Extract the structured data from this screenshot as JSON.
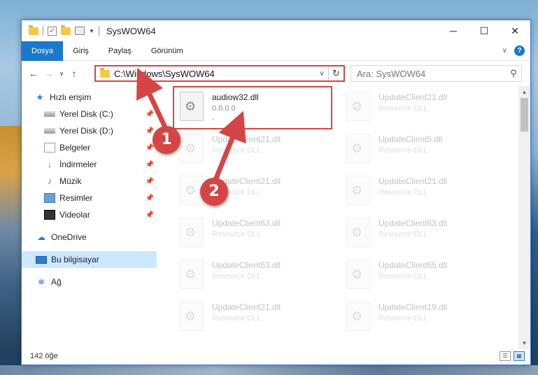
{
  "window": {
    "title": "SysWOW64",
    "controls": {
      "minimize": "─",
      "maximize": "☐",
      "close": "✕"
    }
  },
  "ribbon": {
    "tabs": [
      "Dosya",
      "Giriş",
      "Paylaş",
      "Görünüm"
    ],
    "help": "?"
  },
  "address": {
    "path": "C:\\Windows\\SysWOW64",
    "search_placeholder": "Ara: SysWOW64"
  },
  "nav": {
    "items": [
      {
        "label": "Hızlı erişim",
        "icon": "star-icon",
        "pinned": false
      },
      {
        "label": "Yerel Disk (C:)",
        "icon": "drive-icon",
        "pinned": true
      },
      {
        "label": "Yerel Disk (D:)",
        "icon": "drive-icon",
        "pinned": true
      },
      {
        "label": "Belgeler",
        "icon": "document-icon",
        "pinned": true
      },
      {
        "label": "İndirmeler",
        "icon": "download-icon",
        "pinned": true
      },
      {
        "label": "Müzik",
        "icon": "music-icon",
        "pinned": true
      },
      {
        "label": "Resimler",
        "icon": "pictures-icon",
        "pinned": true
      },
      {
        "label": "Videolar",
        "icon": "video-icon",
        "pinned": true
      },
      {
        "label": "OneDrive",
        "icon": "cloud-icon",
        "pinned": false
      },
      {
        "label": "Bu bilgisayar",
        "icon": "computer-icon",
        "pinned": false,
        "selected": true
      },
      {
        "label": "Ağ",
        "icon": "network-icon",
        "pinned": false
      }
    ]
  },
  "files": [
    {
      "name": "audiow32.dll",
      "sub1": "0.0.0.0",
      "sub2": "-",
      "highlighted": true
    },
    {
      "name": "UpdateClient21.dll",
      "sub1": "Resource DLL"
    },
    {
      "name": "UpdateClient21.dll",
      "sub1": "Resource DLL"
    },
    {
      "name": "UpdateClient5.dll",
      "sub1": "Resource DLL"
    },
    {
      "name": "UpdateClient21.dll",
      "sub1": "Resource DLL"
    },
    {
      "name": "UpdateClient21.dll",
      "sub1": "Resource DLL"
    },
    {
      "name": "UpdateClient63.dll",
      "sub1": "Resource DLL"
    },
    {
      "name": "UpdateClient63.dll",
      "sub1": "Resource DLL"
    },
    {
      "name": "UpdateClient63.dll",
      "sub1": "Resource DLL"
    },
    {
      "name": "UpdateClient65.dll",
      "sub1": "Resource DLL"
    },
    {
      "name": "UpdateClient21.dll",
      "sub1": "Resource DLL"
    },
    {
      "name": "UpdateClient19.dll",
      "sub1": "Resource DLL"
    }
  ],
  "status": {
    "count": "142 öğe"
  },
  "annotations": {
    "step1": "1",
    "step2": "2"
  },
  "colors": {
    "accent": "#1979ca",
    "highlight": "#d64545",
    "selected": "#cce8ff"
  }
}
